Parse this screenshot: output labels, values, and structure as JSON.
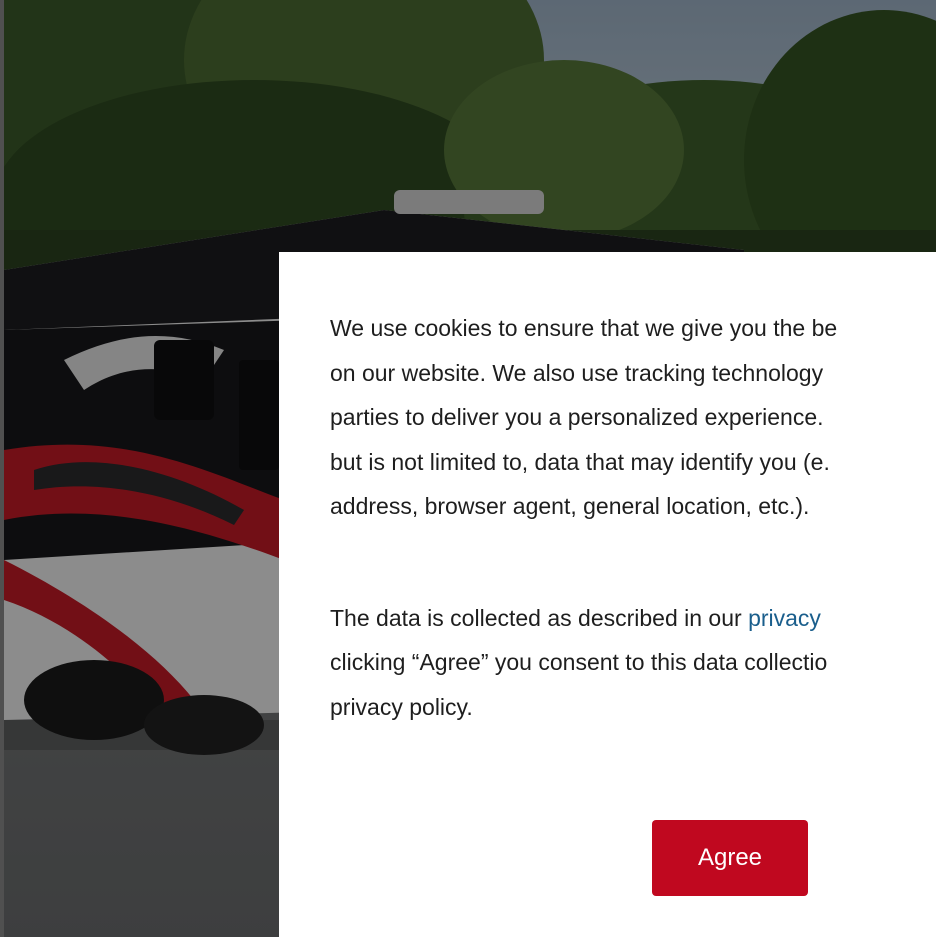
{
  "consent": {
    "paragraph1_lines": [
      "We use cookies to ensure that we give you the be",
      "on our website. We also use tracking technology",
      "parties to deliver you a personalized experience.",
      "but is not limited to, data that may identify you (e.",
      "address, browser agent, general location, etc.)."
    ],
    "paragraph2_line1_prefix": "The data is collected as described in our ",
    "paragraph2_link_text": "privacy",
    "paragraph2_lines_rest": [
      "clicking “Agree” you consent to this data collectio",
      "privacy policy."
    ],
    "agree_label": "Agree"
  },
  "colors": {
    "agree_button": "#c0081f",
    "link": "#1a5e8c",
    "modal_background": "#ffffff",
    "text": "#1e1e1e"
  },
  "background_image": "rv-motorhome-parked-under-trees"
}
